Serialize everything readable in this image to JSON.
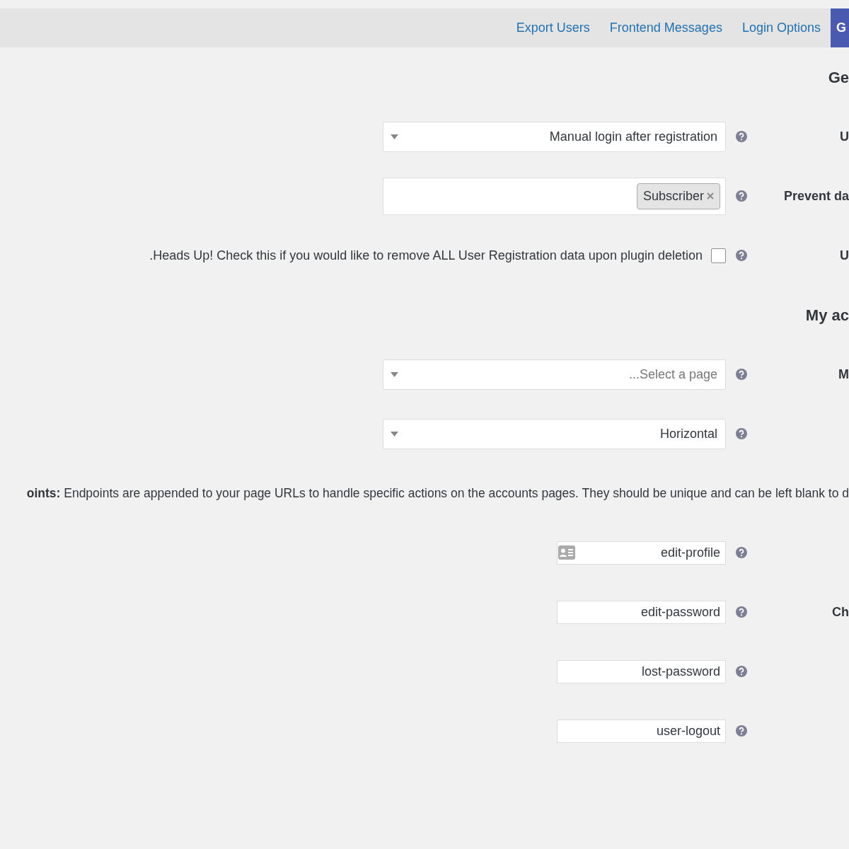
{
  "tabs": [
    {
      "label": "Export Users",
      "selected": false
    },
    {
      "label": "Frontend Messages",
      "selected": false
    },
    {
      "label": "Login Options",
      "selected": false
    },
    {
      "label": "G",
      "selected": true
    }
  ],
  "rows": [
    {
      "kind": "heading",
      "label": "Ge"
    },
    {
      "kind": "select",
      "label": "U",
      "value": "Manual login after registration",
      "help": true
    },
    {
      "kind": "multiselect",
      "label": "Prevent da",
      "tags": [
        "Subscriber"
      ],
      "help": true
    },
    {
      "kind": "checkbox",
      "label": "U",
      "text": ".Heads Up! Check this if you would like to remove ALL User Registration data upon plugin deletion",
      "checked": false,
      "help": true
    },
    {
      "kind": "heading",
      "label": "My ac"
    },
    {
      "kind": "select",
      "label": "M",
      "placeholder": "...Select a page",
      "help": true
    },
    {
      "kind": "select",
      "label": "",
      "value": "Horizontal",
      "help": true
    },
    {
      "kind": "paragraph",
      "text": "**oints:** Endpoints are appended to your page URLs to handle specific actions on the accounts pages. They should be unique and can be left blank to d"
    },
    {
      "kind": "text",
      "label": "",
      "value": "edit-profile",
      "card_icon": true,
      "help": true
    },
    {
      "kind": "text",
      "label": "Ch",
      "value": "edit-password",
      "help": true
    },
    {
      "kind": "text",
      "label": "",
      "value": "lost-password",
      "help": true
    },
    {
      "kind": "text",
      "label": "",
      "value": "user-logout",
      "help": true
    }
  ]
}
